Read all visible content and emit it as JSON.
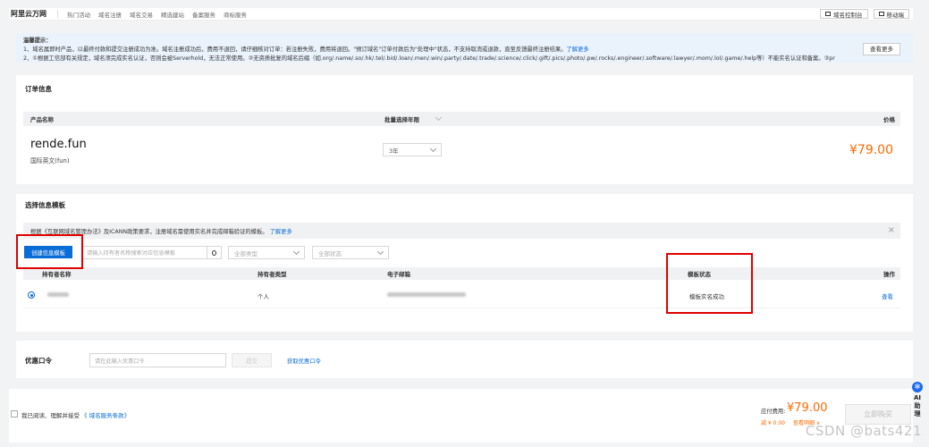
{
  "topbar": {
    "logo": "阿里云万网",
    "nav": [
      "热门活动",
      "域名注册",
      "域名交易",
      "精选建站",
      "备案服务",
      "商标服务"
    ],
    "console_label": "域名控制台",
    "mobile_label": "移动端"
  },
  "notice": {
    "title": "温馨提示：",
    "line1": "1、域名属即时产品，以最终付款和提交注册成功为准。域名注册成功后，费用不退回，请仔细核对订单：若注册失败，费用将退回。\"预订域名\"订单付款后为\"处理中\"状态，不支持取消或退款，直至反馈最终注册结果。",
    "line1_link": "了解更多",
    "line2": "2、①根据工信部有关规定，域名须完成实名认证，否则会被Serverhold，无法正常使用。②无资质批复的域名后缀（如.org/.name/.so/.hk/.tel/.bid/.loan/.men/.win/.party/.date/.trade/.science/.click/.gift/.pics/.photo/.pw/.rocks/.engineer/.software/.lawyer/.mom/.lol/.game/.help等）不能实名认证和备案。③pr",
    "more_button": "查看更多"
  },
  "order": {
    "title": "订单信息",
    "col_product": "产品名称",
    "col_years": "批量选择年限",
    "col_price": "价格",
    "domain": "rende.fun",
    "domain_type": "国际英文(fun)",
    "years_value": "3年",
    "price": "¥79.00"
  },
  "template": {
    "title": "选择信息模板",
    "info_text": "根据《互联网域名管理办法》及ICANN政策要求，注册域名需使用实名并完成邮箱验证的模板。",
    "info_link": "了解更多",
    "create_button": "创建信息模板",
    "search_placeholder": "请输入持有者名称搜索对应信息模板",
    "filter_type": "全部类型",
    "filter_status": "全部状态",
    "columns": [
      "持有者名称",
      "持有者类型",
      "电子邮箱",
      "模板状态",
      "操作"
    ],
    "row": {
      "holder_type": "个人",
      "status": "模板实名成功",
      "action": "查看"
    }
  },
  "coupon": {
    "label": "优惠口令",
    "placeholder": "请在此输入优惠口令",
    "submit": "提交",
    "get_link": "获取优惠口令"
  },
  "footer": {
    "agree_text": "我已阅读、理解并接受",
    "agree_link": "《 域名服务条款》",
    "payable_label": "应付费用:",
    "payable_amount": "¥79.00",
    "discount": "减 ¥ 0.00",
    "detail_link": "查看明细 ∨",
    "buy_button": "立即购买"
  },
  "ai_bar": {
    "label_a": "AI",
    "label_b": "助",
    "label_c": "理"
  },
  "watermark": "CSDN @bats421",
  "colors": {
    "accent": "#0a6cd6",
    "price": "#ff6a00",
    "highlight": "#e00000"
  }
}
